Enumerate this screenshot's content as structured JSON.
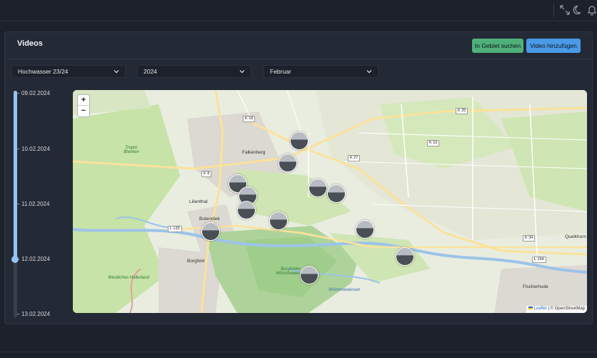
{
  "header": {
    "icons": [
      "expand-icon",
      "moon-icon",
      "bell-icon"
    ]
  },
  "card": {
    "title": "Videos",
    "search_area_label": "In Gebiet suchen",
    "add_video_label": "Video hinzufügen"
  },
  "filters": {
    "event": "Hochwasser 23/24",
    "year": "2024",
    "month": "Februar"
  },
  "timeline": {
    "dates": [
      "09.02.2024",
      "10.02.2024",
      "11.02.2024",
      "12.02.2024",
      "13.02.2024"
    ],
    "selected": "12.02.2024",
    "progress": 0.75
  },
  "map": {
    "zoom_in": "+",
    "zoom_out": "−",
    "attribution_link": "Leaflet",
    "attribution_rest": " | © OpenStreetMap",
    "places": {
      "falkenberg": "Falkenberg",
      "lilienthal": "Lilienthal",
      "butendiek": "Butendiek",
      "borgfeld": "Borgfeld",
      "fischerhude": "Fischerhude",
      "quelkhorn": "Quelkhorn",
      "westliches_hollerland": "Westliches Hollerland",
      "truper_blanken": "Truper Blanken",
      "borgfelder_wummewiesen": "Borgfelder Wümmewiesen",
      "wummewiesen": "Wümmewiesen"
    },
    "roads": {
      "k18": "K 18",
      "k8": "K 8",
      "k27": "K 27",
      "k10": "K 10",
      "k25": "K 25",
      "l133": "L 133",
      "k34": "K 34",
      "l154": "L 154"
    },
    "colors": {
      "land": "#e9ede0",
      "meadow": "#c7e3a7",
      "forest": "#aed39a",
      "urban": "#dcd8d2",
      "water": "#9cc3e8",
      "road": "#fbe29a",
      "primary": "#ffffff"
    },
    "video_marker_count": 13
  }
}
